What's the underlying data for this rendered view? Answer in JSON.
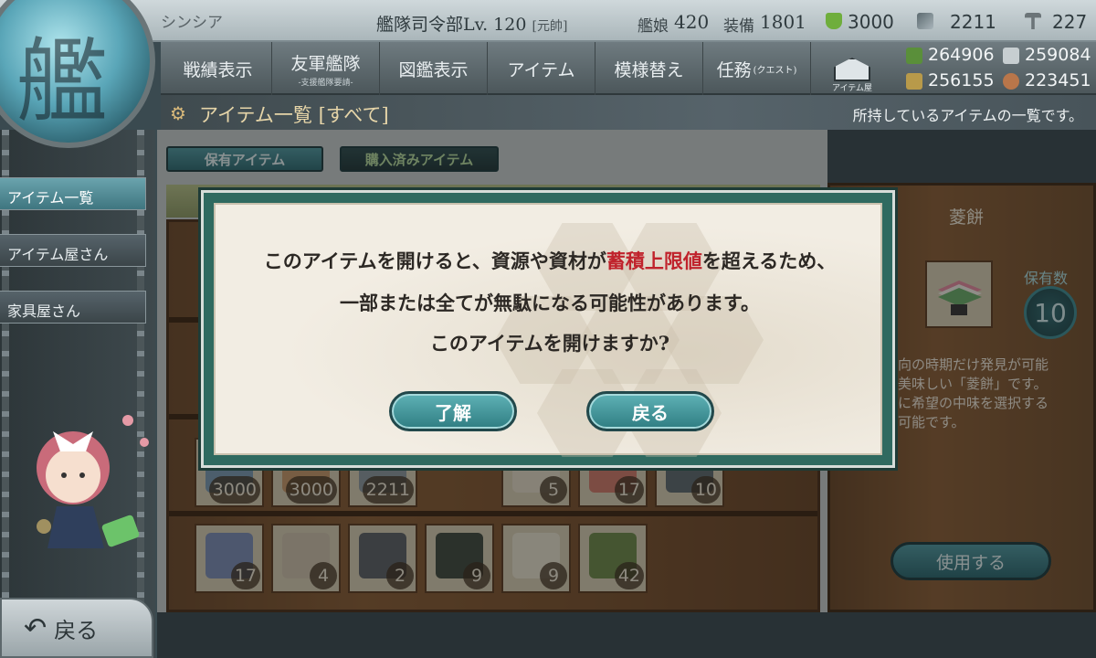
{
  "header": {
    "player_name": "シンシア",
    "hq_level": "艦隊司令部Lv. 120",
    "rank": "[元帥]",
    "ships_label": "艦娘",
    "ships_count": "420",
    "equipment_label": "装備",
    "equipment_count": "1801",
    "buckets": "3000",
    "dev_materials": "2211",
    "screws": "227"
  },
  "nav": {
    "record": "戦績表示",
    "friend_fleet": "友軍艦隊",
    "friend_fleet_sub": "-支援艦隊要請-",
    "encyclopedia": "図鑑表示",
    "items": "アイテム",
    "decorate": "模様替え",
    "quests": "任務",
    "quests_sub": "(クエスト)",
    "shop": "アイテム屋"
  },
  "resources": {
    "fuel": "264906",
    "steel": "259084",
    "ammo": "256155",
    "bauxite": "223451"
  },
  "title": {
    "text": "アイテム一覧 [すべて]",
    "description": "所持しているアイテムの一覧です。"
  },
  "sidebar": {
    "items": [
      {
        "label": "アイテム一覧"
      },
      {
        "label": "アイテム屋さん"
      },
      {
        "label": "家具屋さん"
      }
    ],
    "back_label": "戻る"
  },
  "tabs": {
    "owned": "保有アイテム",
    "purchased": "購入済みアイテム"
  },
  "shelf_row1": [
    "3000",
    "3000",
    "2211",
    "5",
    "17",
    "10"
  ],
  "shelf_row2": [
    "17",
    "4",
    "2",
    "9",
    "9",
    "42"
  ],
  "detail": {
    "name": "菱餅",
    "owned_label": "保有数",
    "owned_count": "10",
    "desc_line1": "向の時期だけ発見が可能",
    "desc_line2": "美味しい「菱餅」です。",
    "desc_line3": "に希望の中味を選択する",
    "desc_line4": "可能です。",
    "use_label": "使用する"
  },
  "dialog": {
    "line1_pre": "このアイテムを開けると、資源や資材が",
    "line1_accent": "蓄積上限値",
    "line1_post": "を超えるため、",
    "line2": "一部または全てが無駄になる可能性があります。",
    "line3": "このアイテムを開けますか?",
    "confirm": "了解",
    "cancel": "戻る"
  },
  "colors": {
    "dialog_frame": "#2f6a60",
    "dialog_bg": "#f2ede3",
    "accent_red": "#c0232c",
    "button_teal": "#3f8f94"
  }
}
